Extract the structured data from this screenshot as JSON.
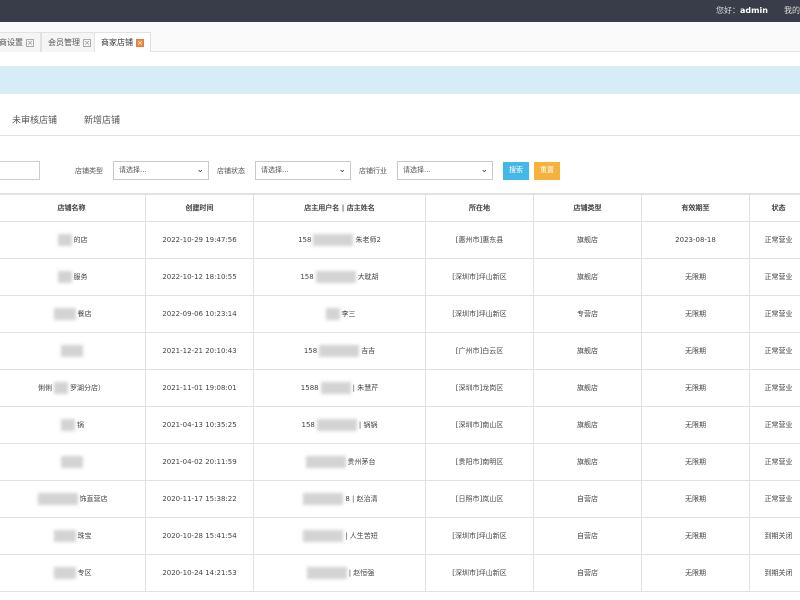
{
  "header": {
    "greeting_prefix": "您好：",
    "username": "admin",
    "mine": "我的"
  },
  "tabs": [
    {
      "label": "商设置"
    },
    {
      "label": "会员管理"
    },
    {
      "label": "商家店铺",
      "active": true
    }
  ],
  "subtabs": [
    "未审核店铺",
    "新增店铺"
  ],
  "filters": {
    "shop_type_label": "店铺类型",
    "shop_status_label": "店铺状态",
    "shop_industry_label": "店铺行业",
    "select_placeholder": "请选择...",
    "search_button": "搜索",
    "reset_button": "重置"
  },
  "table": {
    "columns": [
      "店铺名称",
      "创建时间",
      "店主用户名 | 店主姓名",
      "所在地",
      "店铺类型",
      "有效期至",
      "状态"
    ],
    "rows": [
      {
        "name_pre": "",
        "name": "的店",
        "created": "2022-10-29 19:47:56",
        "owner_pre": "158",
        "owner": "朱老师2",
        "location": "[惠州市]惠东县",
        "type": "旗舰店",
        "valid": "2023-08-18",
        "status": "正常营业"
      },
      {
        "name_pre": "",
        "name": "服务",
        "created": "2022-10-12 18:10:55",
        "owner_pre": "158",
        "owner": "大耽胡",
        "location": "[深圳市]坪山新区",
        "type": "旗舰店",
        "valid": "无限期",
        "status": "正常营业"
      },
      {
        "name_pre": "",
        "name": "餐店",
        "created": "2022-09-06 10:23:14",
        "owner_pre": "",
        "owner": "李三",
        "location": "[深圳市]坪山新区",
        "type": "专营店",
        "valid": "无限期",
        "status": "正常营业"
      },
      {
        "name_pre": "",
        "name": "",
        "created": "2021-12-21 20:10:43",
        "owner_pre": "158",
        "owner": "吉吉",
        "location": "[广州市]白云区",
        "type": "旗舰店",
        "valid": "无限期",
        "status": "正常营业"
      },
      {
        "name_pre": "俐俐",
        "name": "罗湖分店）",
        "created": "2021-11-01 19:08:01",
        "owner_pre": "1588",
        "owner": "| 朱慧芹",
        "location": "[深圳市]龙岗区",
        "type": "旗舰店",
        "valid": "无限期",
        "status": "正常营业"
      },
      {
        "name_pre": "",
        "name": "锅",
        "created": "2021-04-13 10:35:25",
        "owner_pre": "158",
        "owner": "| 锅锅",
        "location": "[深圳市]南山区",
        "type": "旗舰店",
        "valid": "无限期",
        "status": "正常营业"
      },
      {
        "name_pre": "",
        "name": "",
        "created": "2021-04-02 20:11:59",
        "owner_pre": "",
        "owner": "贵州茅台",
        "location": "[贵阳市]南明区",
        "type": "旗舰店",
        "valid": "无限期",
        "status": "正常营业"
      },
      {
        "name_pre": "",
        "name": "饰直营店",
        "created": "2020-11-17 15:38:22",
        "owner_pre": "",
        "owner": "8 | 赵治清",
        "location": "[日照市]岚山区",
        "type": "自营店",
        "valid": "无限期",
        "status": "正常营业"
      },
      {
        "name_pre": "",
        "name": "珠宝",
        "created": "2020-10-28 15:41:54",
        "owner_pre": "",
        "owner": "| 人生苦短",
        "location": "[深圳市]坪山新区",
        "type": "自营店",
        "valid": "无限期",
        "status": "到期关闭"
      },
      {
        "name_pre": "",
        "name": "专区",
        "created": "2020-10-24 14:21:53",
        "owner_pre": "",
        "owner": "| 赵恒强",
        "location": "[深圳市]坪山新区",
        "type": "自营店",
        "valid": "无限期",
        "status": "到期关闭"
      }
    ]
  }
}
